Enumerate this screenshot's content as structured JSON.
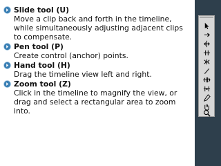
{
  "bullets": [
    {
      "title": "Slide tool (U)",
      "description": "Move a clip back and forth in the timeline, while simultaneously adjusting adjacent clips to compensate."
    },
    {
      "title": "Pen tool (P)",
      "description": "Create control (anchor) points."
    },
    {
      "title": "Hand tool (H)",
      "description": "Drag the timeline view left and right."
    },
    {
      "title": "Zoom tool (Z)",
      "description": "Click in the timeline to magnify the view, or drag and select a rectangular area to zoom into."
    }
  ],
  "toolbar": {
    "tools": [
      {
        "icon": "selection-arrow-icon"
      },
      {
        "icon": "track-select-icon"
      },
      {
        "icon": "ripple-edit-icon"
      },
      {
        "icon": "rolling-edit-icon"
      },
      {
        "icon": "rate-stretch-icon"
      },
      {
        "icon": "razor-icon"
      },
      {
        "icon": "slip-tool-icon"
      },
      {
        "icon": "slide-tool-icon"
      },
      {
        "icon": "pen-tool-icon"
      },
      {
        "icon": "hand-tool-icon"
      },
      {
        "icon": "zoom-tool-icon"
      }
    ]
  },
  "colors": {
    "panel_background": "#2e3f4c",
    "toolbar_background": "#d7d7d7",
    "bullet_arrow": "#3a7fb4"
  }
}
